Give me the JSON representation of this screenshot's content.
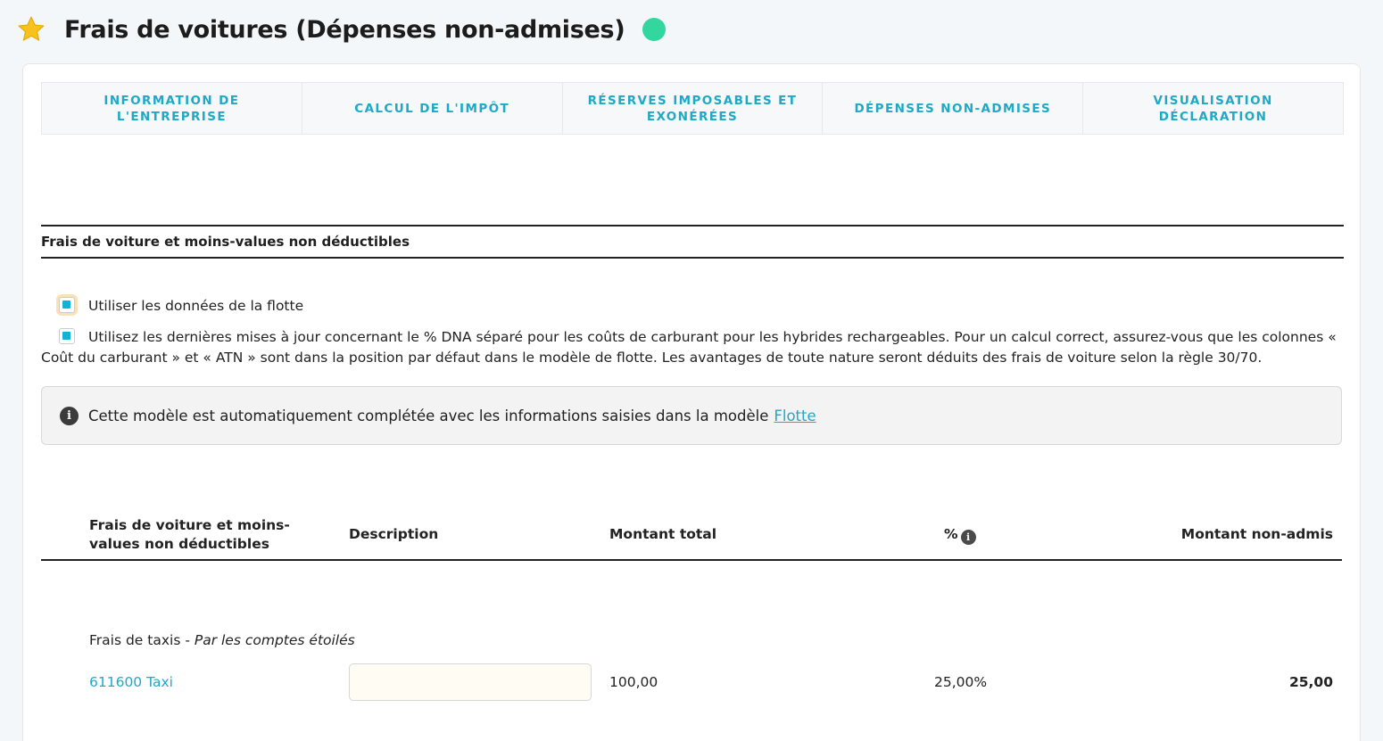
{
  "header": {
    "title": "Frais de voitures (Dépenses non-admises)",
    "star_icon": "star-icon",
    "status_color": "#33d69f"
  },
  "tabs": [
    {
      "label": "INFORMATION DE L'ENTREPRISE"
    },
    {
      "label": "CALCUL DE L'IMPÔT"
    },
    {
      "label": "RÉSERVES IMPOSABLES ET EXONÉRÉES"
    },
    {
      "label": "DÉPENSES NON-ADMISES"
    },
    {
      "label": "VISUALISATION DÉCLARATION"
    }
  ],
  "section": {
    "title": "Frais de voiture et moins-values non déductibles"
  },
  "options": {
    "use_fleet_label": "Utiliser les données de la flotte",
    "use_fleet_checked": true,
    "latest_updates_label": "Utilisez les dernières mises à jour concernant le % DNA séparé pour les coûts de carburant pour les hybrides rechargeables. Pour un calcul correct, assurez-vous que les colonnes « Coût du carburant » et « ATN » sont dans la position par défaut dans le modèle de flotte. Les avantages de toute nature seront déduits des frais de voiture selon la règle 30/70.",
    "latest_updates_checked": true
  },
  "info": {
    "text": "Cette modèle est automatiquement complétée avec les informations saisies dans la modèle",
    "link": "Flotte"
  },
  "table": {
    "columns": {
      "category": "Frais de voiture et moins-values non déductibles",
      "description": "Description",
      "total": "Montant total",
      "percent": "%",
      "non_admis": "Montant non-admis"
    },
    "group": {
      "label": "Frais de taxis",
      "note": "Par les comptes étoilés"
    },
    "rows": [
      {
        "account": "611600 Taxi",
        "description": "",
        "total": "100,00",
        "percent": "25,00%",
        "non_admis": "25,00"
      }
    ]
  }
}
